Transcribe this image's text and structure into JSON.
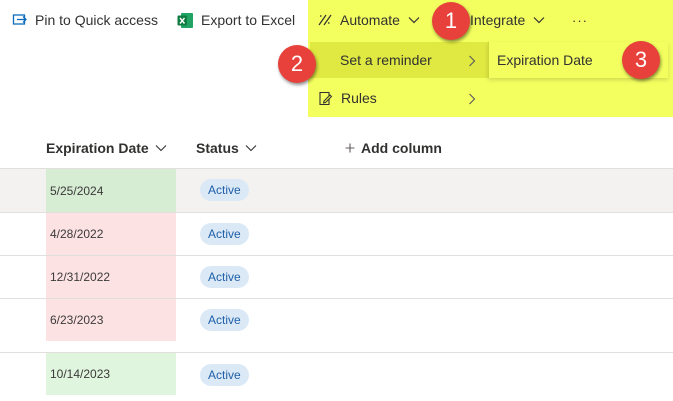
{
  "toolbar": {
    "pin_label": "Pin to Quick access",
    "export_label": "Export to Excel",
    "automate_label": "Automate",
    "integrate_label": "Integrate",
    "more_label": "···"
  },
  "automate_menu": {
    "reminder_label": "Set a reminder",
    "rules_label": "Rules"
  },
  "reminder_submenu": {
    "expiration_label": "Expiration Date"
  },
  "callouts": [
    "1",
    "2",
    "3"
  ],
  "table": {
    "headers": {
      "expiration": "Expiration Date",
      "status": "Status",
      "add_column": "Add column"
    },
    "rows": [
      {
        "date": "5/25/2024",
        "status": "Active",
        "cell_color": "#d6ecd3"
      },
      {
        "date": "4/28/2022",
        "status": "Active",
        "cell_color": "#fde2e4"
      },
      {
        "date": "12/31/2022",
        "status": "Active",
        "cell_color": "#fde2e4"
      },
      {
        "date": "6/23/2023",
        "status": "Active",
        "cell_color": "#fde2e4"
      },
      {
        "date": "10/14/2023",
        "status": "Active",
        "cell_color": "#dff5dd"
      }
    ]
  },
  "colors": {
    "highlight": "#f0ff3c",
    "callout": "#e8403a",
    "badge_bg": "#dbe9f7",
    "badge_text": "#1f5fa8",
    "selected_row": "#f3f2f1"
  },
  "icons": [
    "pin-icon",
    "excel-icon",
    "automate-icon",
    "rules-icon",
    "chevron-down-icon",
    "chevron-right-icon",
    "plus-icon"
  ]
}
